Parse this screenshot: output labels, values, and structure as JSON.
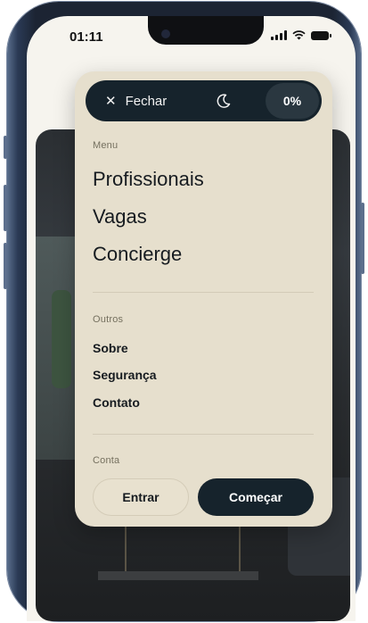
{
  "status_bar": {
    "time": "01:11"
  },
  "menu": {
    "close_label": "Fechar",
    "progress": "0%",
    "theme_toggle_icon": "moon-icon",
    "sections": {
      "main_label": "Menu",
      "main_items": [
        "Profissionais",
        "Vagas",
        "Concierge"
      ],
      "other_label": "Outros",
      "other_items": [
        "Sobre",
        "Segurança",
        "Contato"
      ],
      "account_label": "Conta"
    },
    "actions": {
      "login": "Entrar",
      "start": "Começar"
    }
  },
  "colors": {
    "panel_bg": "#e6dfcd",
    "dark_accent": "#16232c",
    "text": "#161b20"
  }
}
